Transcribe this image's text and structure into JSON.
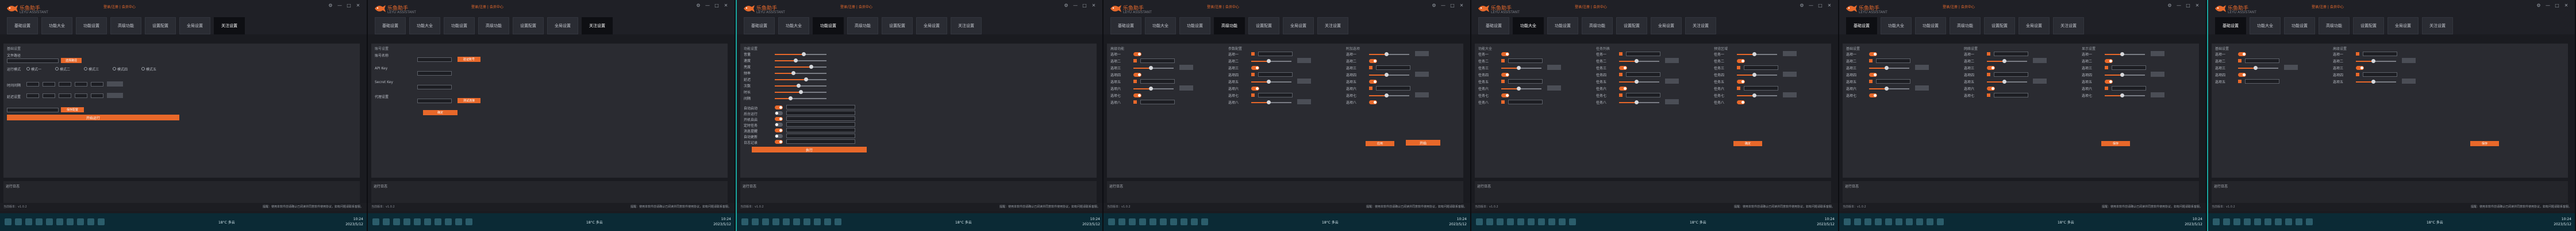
{
  "app": {
    "title": "乐鱼助手",
    "subtitle": "LEYU ASSISTANT",
    "login_link": "登录/注册 | 会员中心",
    "win_controls": [
      "⚙",
      "—",
      "□",
      "✕"
    ]
  },
  "tabs": [
    "基础设置",
    "功能大全",
    "功能设置",
    "高级功能",
    "设置配置",
    "全局设置",
    "关注设置"
  ],
  "log": {
    "title": "运行日志"
  },
  "status": {
    "left": "当前版本：v1.0.2",
    "right": "提醒：使用本软件前请确认已阅读并同意软件使用协议，如有问题请联系客服。"
  },
  "taskbar": {
    "search": "搜索",
    "weather": "18°C 多云",
    "time": "10:24",
    "date": "2023/5/12"
  },
  "panels": [
    {
      "active_tab": 6,
      "section": "基础设置",
      "input_label": "文件路径",
      "path_button": "选择路径",
      "mode_label": "运行模式",
      "modes": [
        "模式一",
        "模式二",
        "模式三",
        "模式四",
        "模式五"
      ],
      "interval_label": "时间间隔",
      "delay_label": "延迟设置",
      "save_button": "保存配置",
      "start_button": "开始运行"
    },
    {
      "active_tab": 6,
      "section": "账号设置",
      "account_label": "账号名称",
      "verify_button": "验证账号",
      "api_label": "API Key",
      "secret_label": "Secret Key",
      "proxy_label": "代理设置",
      "test_button": "测试连接",
      "confirm_button": "确定"
    },
    {
      "active_tab": 2,
      "section": "功能设置",
      "sliders": [
        "音量",
        "速度",
        "亮度",
        "频率",
        "延迟",
        "次数",
        "时长",
        "间隔"
      ],
      "slider_values": [
        0.55,
        0.4,
        0.7,
        0.35,
        0.6,
        0.45,
        0.5,
        0.3
      ],
      "options": [
        "自动启动",
        "后台运行",
        "开机自启",
        "定时任务",
        "消息提醒",
        "自动更新",
        "日志记录"
      ],
      "run_button": "执行"
    },
    {
      "active_tab": 3,
      "col1": "高级功能",
      "col2": "参数配置",
      "col3": "附加选项",
      "rows": [
        "选项一",
        "选项二",
        "选项三",
        "选项四",
        "选项五",
        "选项六",
        "选项七",
        "选项八"
      ],
      "apply_button": "应用",
      "start_button": "开始"
    },
    {
      "active_tab": 1,
      "col1": "功能大全",
      "col2": "任务列表",
      "col3": "预览区域",
      "rows": [
        "任务一",
        "任务二",
        "任务三",
        "任务四",
        "任务五",
        "任务六",
        "任务七",
        "任务八"
      ],
      "confirm_button": "确定"
    },
    {
      "active_tab": 0,
      "col1": "基础设置",
      "col2": "网络设置",
      "col3": "显示设置",
      "rows": [
        "选项一",
        "选项二",
        "选项三",
        "选项四",
        "选项五",
        "选项六",
        "选项七"
      ],
      "save_button": "保存"
    },
    {
      "active_tab": 0,
      "col1": "基础设置",
      "col2": "高级设置",
      "rows": [
        "选项一",
        "选项二",
        "选项三",
        "选项四",
        "选项五"
      ],
      "save_button": "保存"
    }
  ]
}
